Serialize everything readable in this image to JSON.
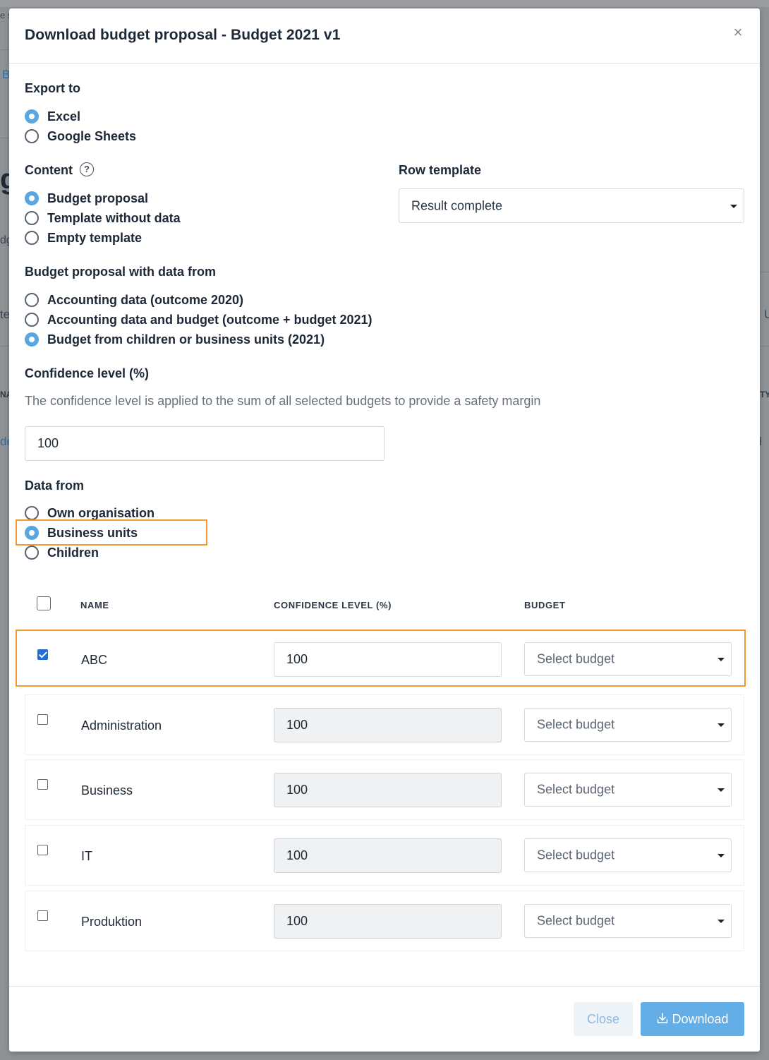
{
  "modal": {
    "title": "Download budget proposal - Budget 2021 v1",
    "close_icon": "×"
  },
  "background": {
    "frag1": "e s",
    "frag2": "B",
    "frag3": "g",
    "frag4": "dg",
    "frag5": "te",
    "frag6": "U",
    "frag7": "NA",
    "frag8": "TY",
    "frag9": "de",
    "frag10": "l"
  },
  "export_to": {
    "label": "Export to",
    "options": [
      {
        "label": "Excel",
        "checked": true
      },
      {
        "label": "Google Sheets",
        "checked": false
      }
    ]
  },
  "content": {
    "label": "Content",
    "help_icon": "?",
    "options": [
      {
        "label": "Budget proposal",
        "checked": true
      },
      {
        "label": "Template without data",
        "checked": false
      },
      {
        "label": "Empty template",
        "checked": false
      }
    ]
  },
  "row_template": {
    "label": "Row template",
    "value": "Result complete"
  },
  "data_source": {
    "label": "Budget proposal with data from",
    "options": [
      {
        "label": "Accounting data (outcome 2020)",
        "checked": false
      },
      {
        "label": "Accounting data and budget (outcome + budget 2021)",
        "checked": false
      },
      {
        "label": "Budget from children or business units (2021)",
        "checked": true
      }
    ]
  },
  "confidence": {
    "label": "Confidence level (%)",
    "description": "The confidence level is applied to the sum of all selected budgets to provide a safety margin",
    "value": "100"
  },
  "data_from": {
    "label": "Data from",
    "options": [
      {
        "label": "Own organisation",
        "checked": false
      },
      {
        "label": "Business units",
        "checked": true
      },
      {
        "label": "Children",
        "checked": false
      }
    ]
  },
  "table": {
    "headers": {
      "name": "NAME",
      "confidence": "CONFIDENCE LEVEL (%)",
      "budget": "BUDGET"
    },
    "rows": [
      {
        "name": "ABC",
        "confidence": "100",
        "budget_placeholder": "Select budget",
        "checked": true
      },
      {
        "name": "Administration",
        "confidence": "100",
        "budget_placeholder": "Select budget",
        "checked": false
      },
      {
        "name": "Business",
        "confidence": "100",
        "budget_placeholder": "Select budget",
        "checked": false
      },
      {
        "name": "IT",
        "confidence": "100",
        "budget_placeholder": "Select budget",
        "checked": false
      },
      {
        "name": "Produktion",
        "confidence": "100",
        "budget_placeholder": "Select budget",
        "checked": false
      }
    ]
  },
  "footer": {
    "close_label": "Close",
    "download_label": "Download",
    "download_icon": "download-icon"
  },
  "colors": {
    "accent": "#5aa6e0",
    "highlight": "#f29a2e",
    "checkbox_checked": "#1f6fd6"
  }
}
